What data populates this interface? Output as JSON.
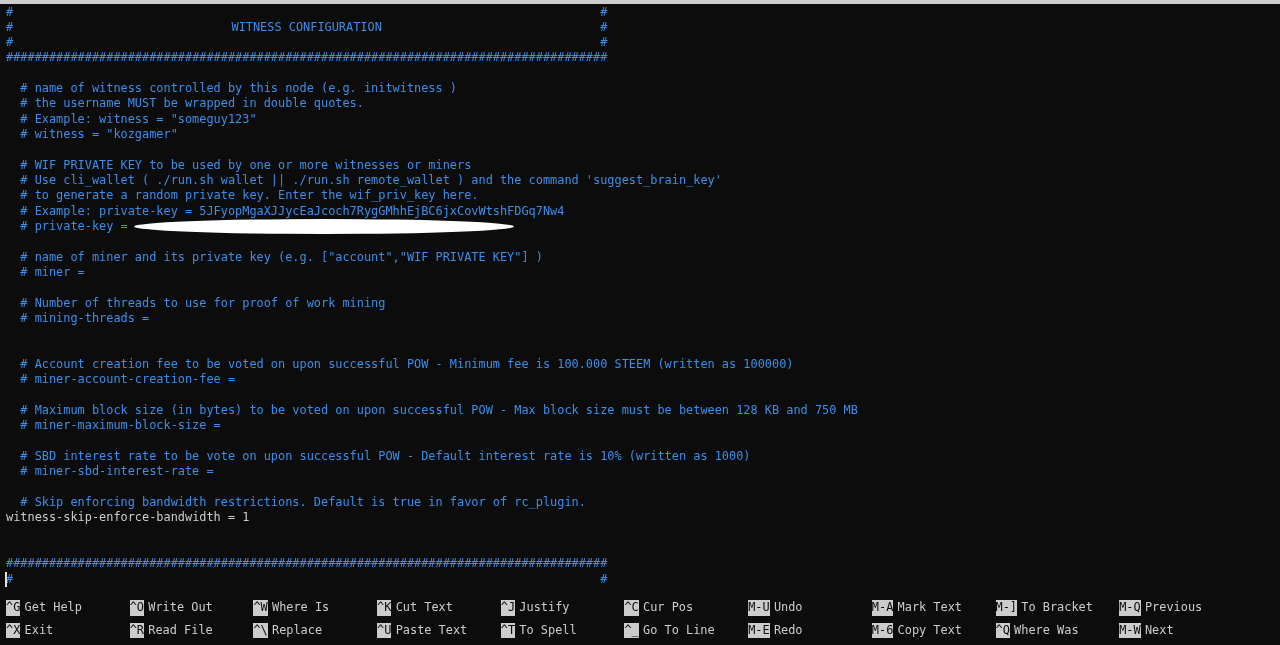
{
  "editor": {
    "lines": [
      {
        "kind": "frame",
        "left": "#",
        "right": "#"
      },
      {
        "kind": "title",
        "left": "#",
        "center": "WITNESS CONFIGURATION",
        "right": "#"
      },
      {
        "kind": "frame",
        "left": "#",
        "right": "#"
      },
      {
        "kind": "rule",
        "text": "####################################################################################"
      },
      {
        "kind": "blank"
      },
      {
        "kind": "comment",
        "text": "# name of witness controlled by this node (e.g. initwitness )"
      },
      {
        "kind": "comment",
        "text": "# the username MUST be wrapped in double quotes."
      },
      {
        "kind": "comment",
        "text": "# Example: witness = \"someguy123\""
      },
      {
        "kind": "comment",
        "text": "# witness = \"kozgamer\""
      },
      {
        "kind": "blank"
      },
      {
        "kind": "comment",
        "text": "# WIF PRIVATE KEY to be used by one or more witnesses or miners"
      },
      {
        "kind": "comment",
        "text": "# Use cli_wallet ( ./run.sh wallet || ./run.sh remote_wallet ) and the command 'suggest_brain_key'"
      },
      {
        "kind": "comment",
        "text": "# to generate a random private key. Enter the wif_priv_key here."
      },
      {
        "kind": "comment",
        "text": "# Example: private-key = 5JFyopMgaXJJycEaJcoch7RygGMhhEjBC6jxCovWtshFDGq7Nw4"
      },
      {
        "kind": "redacted",
        "text": "# private-key ="
      },
      {
        "kind": "blank"
      },
      {
        "kind": "comment",
        "text": "# name of miner and its private key (e.g. [\"account\",\"WIF PRIVATE KEY\"] )"
      },
      {
        "kind": "comment",
        "text": "# miner ="
      },
      {
        "kind": "blank"
      },
      {
        "kind": "comment",
        "text": "# Number of threads to use for proof of work mining"
      },
      {
        "kind": "comment",
        "text": "# mining-threads ="
      },
      {
        "kind": "blank"
      },
      {
        "kind": "blank"
      },
      {
        "kind": "comment",
        "text": "# Account creation fee to be voted on upon successful POW - Minimum fee is 100.000 STEEM (written as 100000)"
      },
      {
        "kind": "comment",
        "text": "# miner-account-creation-fee ="
      },
      {
        "kind": "blank"
      },
      {
        "kind": "comment",
        "text": "# Maximum block size (in bytes) to be voted on upon successful POW - Max block size must be between 128 KB and 750 MB"
      },
      {
        "kind": "comment",
        "text": "# miner-maximum-block-size ="
      },
      {
        "kind": "blank"
      },
      {
        "kind": "comment",
        "text": "# SBD interest rate to be vote on upon successful POW - Default interest rate is 10% (written as 1000)"
      },
      {
        "kind": "comment",
        "text": "# miner-sbd-interest-rate ="
      },
      {
        "kind": "blank"
      },
      {
        "kind": "comment",
        "text": "# Skip enforcing bandwidth restrictions. Default is true in favor of rc_plugin."
      },
      {
        "kind": "setting",
        "text": "witness-skip-enforce-bandwidth = 1"
      },
      {
        "kind": "blank"
      },
      {
        "kind": "blank"
      },
      {
        "kind": "rule",
        "text": "####################################################################################"
      },
      {
        "kind": "frame",
        "left": "#",
        "right": "#",
        "cursor": true
      }
    ]
  },
  "shortcuts": [
    [
      {
        "key": "^G",
        "label": "Get Help"
      },
      {
        "key": "^O",
        "label": "Write Out"
      },
      {
        "key": "^W",
        "label": "Where Is"
      },
      {
        "key": "^K",
        "label": "Cut Text"
      },
      {
        "key": "^J",
        "label": "Justify"
      },
      {
        "key": "^C",
        "label": "Cur Pos"
      },
      {
        "key": "M-U",
        "label": "Undo"
      },
      {
        "key": "M-A",
        "label": "Mark Text"
      },
      {
        "key": "M-]",
        "label": "To Bracket"
      },
      {
        "key": "M-Q",
        "label": "Previous"
      }
    ],
    [
      {
        "key": "^X",
        "label": "Exit"
      },
      {
        "key": "^R",
        "label": "Read File"
      },
      {
        "key": "^\\",
        "label": "Replace"
      },
      {
        "key": "^U",
        "label": "Paste Text"
      },
      {
        "key": "^T",
        "label": "To Spell"
      },
      {
        "key": "^_",
        "label": "Go To Line"
      },
      {
        "key": "M-E",
        "label": "Redo"
      },
      {
        "key": "M-6",
        "label": "Copy Text"
      },
      {
        "key": "^Q",
        "label": "Where Was"
      },
      {
        "key": "M-W",
        "label": "Next"
      }
    ]
  ]
}
